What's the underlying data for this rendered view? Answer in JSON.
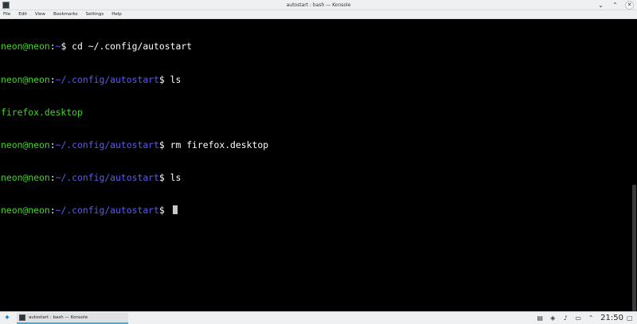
{
  "window": {
    "title": "autostart : bash — Konsole"
  },
  "menubar": {
    "items": [
      "File",
      "Edit",
      "View",
      "Bookmarks",
      "Settings",
      "Help"
    ]
  },
  "terminal": {
    "lines": [
      {
        "user": "neon@neon",
        "sep": ":",
        "path": "~",
        "prompt": "$ ",
        "cmd": "cd ~/.config/autostart"
      },
      {
        "user": "neon@neon",
        "sep": ":",
        "path": "~/.config/autostart",
        "prompt": "$ ",
        "cmd": "ls"
      },
      {
        "output": "firefox.desktop"
      },
      {
        "user": "neon@neon",
        "sep": ":",
        "path": "~/.config/autostart",
        "prompt": "$ ",
        "cmd": "rm firefox.desktop"
      },
      {
        "user": "neon@neon",
        "sep": ":",
        "path": "~/.config/autostart",
        "prompt": "$ ",
        "cmd": "ls"
      },
      {
        "user": "neon@neon",
        "sep": ":",
        "path": "~/.config/autostart",
        "prompt": "$ ",
        "cmd": ""
      }
    ]
  },
  "taskbar": {
    "task_label": "autostart : bash — Konsole",
    "clock": "21:50"
  },
  "colors": {
    "user": "#43d426",
    "path": "#5b5bef",
    "text": "#fcfcfc",
    "background": "#000000"
  },
  "icons": {
    "launcher": "plasma-launcher-icon",
    "tray": [
      "clipboard-icon",
      "network-icon",
      "volume-icon",
      "battery-icon",
      "tray-expand-icon"
    ]
  }
}
